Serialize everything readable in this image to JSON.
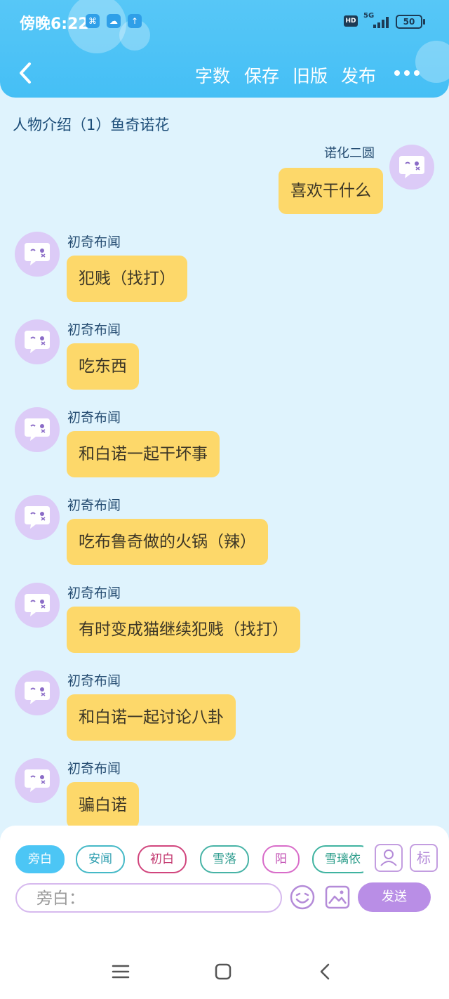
{
  "status_bar": {
    "time": "傍晚6:22",
    "icons": [
      "signal-app-icon",
      "cloud-icon",
      "upload-icon"
    ],
    "hd_label": "HD",
    "network": "5G",
    "battery": "50"
  },
  "toolbar": {
    "back_icon": "back-chevron-icon",
    "actions": [
      "字数",
      "保存",
      "旧版",
      "发布"
    ],
    "more_icon": "more-dots-icon"
  },
  "page": {
    "title": "人物介绍（1）鱼奇诺花"
  },
  "messages": [
    {
      "side": "right",
      "sender": "诺化二圆",
      "text": "喜欢干什么"
    },
    {
      "side": "left",
      "sender": "初奇布闻",
      "text": "犯贱（找打）"
    },
    {
      "side": "left",
      "sender": "初奇布闻",
      "text": "吃东西"
    },
    {
      "side": "left",
      "sender": "初奇布闻",
      "text": "和白诺一起干坏事"
    },
    {
      "side": "left",
      "sender": "初奇布闻",
      "text": "吃布鲁奇做的火锅（辣）"
    },
    {
      "side": "left",
      "sender": "初奇布闻",
      "text": "有时变成猫继续犯贱（找打）"
    },
    {
      "side": "left",
      "sender": "初奇布闻",
      "text": "和白诺一起讨论八卦"
    },
    {
      "side": "left",
      "sender": "初奇布闻",
      "text": "骗白诺"
    }
  ],
  "composer": {
    "characters": [
      {
        "label": "旁白",
        "color": "#4cc6f5",
        "active": true
      },
      {
        "label": "安闻",
        "color": "#45b9c7",
        "active": false
      },
      {
        "label": "初白",
        "color": "#d1457d",
        "active": false
      },
      {
        "label": "雪落",
        "color": "#47b3a6",
        "active": false
      },
      {
        "label": "阳",
        "color": "#d86cc9",
        "active": false
      },
      {
        "label": "雪璃依",
        "color": "#3fb3a0",
        "active": false
      }
    ],
    "role_icon": "person-card-icon",
    "tag_label": "标",
    "input_placeholder": "旁白：",
    "emoji_icon": "emoji-icon",
    "image_icon": "image-icon",
    "send_label": "发送"
  },
  "system_nav": {
    "icons": [
      "menu-icon",
      "home-square-icon",
      "back-icon"
    ]
  },
  "colors": {
    "header": "#4fc4f6",
    "page_bg": "#dff3fd",
    "bubble": "#fdd86a",
    "avatar": "#dccbf7",
    "send": "#b98ee6"
  }
}
